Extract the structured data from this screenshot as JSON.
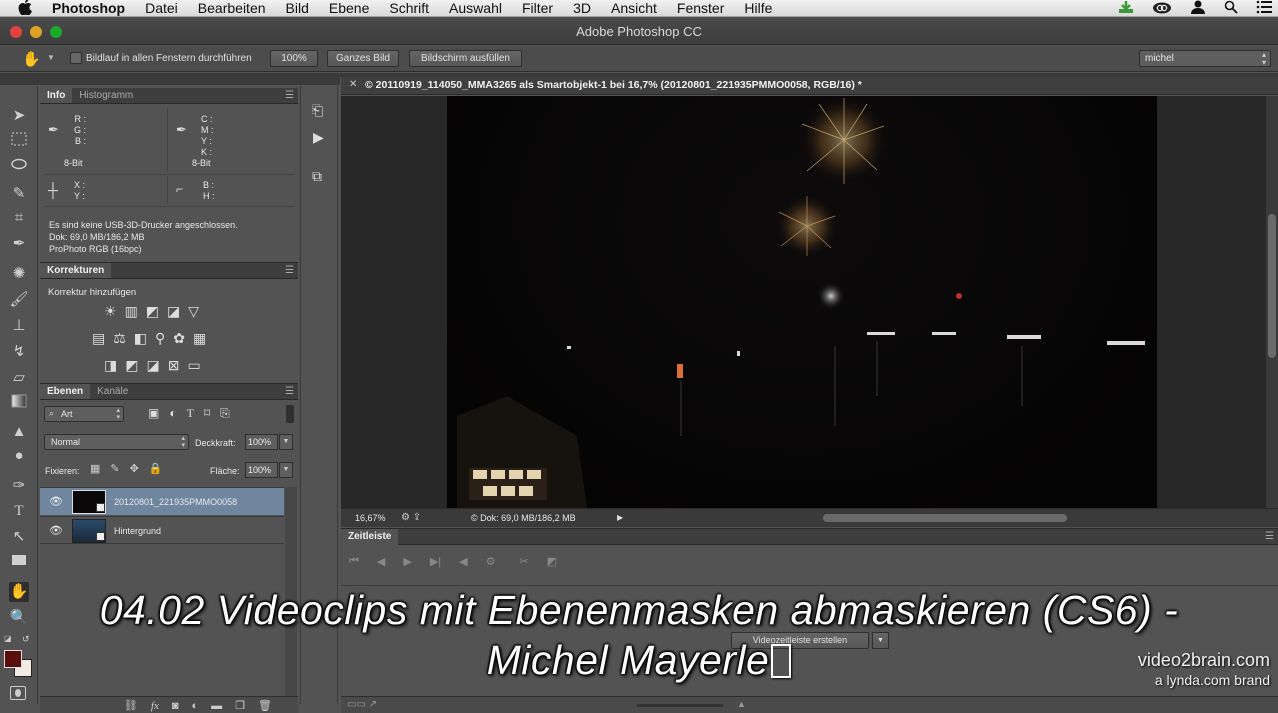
{
  "menubar": {
    "app": "Photoshop",
    "items": [
      "Datei",
      "Bearbeiten",
      "Bild",
      "Ebene",
      "Schrift",
      "Auswahl",
      "Filter",
      "3D",
      "Ansicht",
      "Fenster",
      "Hilfe"
    ]
  },
  "window": {
    "title": "Adobe Photoshop CC"
  },
  "options": {
    "scroll_all_label": "Bildlauf in allen Fenstern durchführen",
    "zoom100": "100%",
    "fit_screen": "Ganzes Bild",
    "fill_screen": "Bildschirm ausfüllen",
    "workspace": "michel"
  },
  "info_panel": {
    "tabs": [
      "Info",
      "Histogramm"
    ],
    "rgb_labels": [
      "R :",
      "G :",
      "B :"
    ],
    "cmyk_labels": [
      "C :",
      "M :",
      "Y :",
      "K :"
    ],
    "bit_left": "8-Bit",
    "bit_right": "8-Bit",
    "xy_labels": [
      "X :",
      "Y :"
    ],
    "wh_labels": [
      "B :",
      "H :"
    ],
    "line1": "Es sind keine USB-3D-Drucker angeschlossen.",
    "line2": "Dok: 69,0 MB/186,2 MB",
    "line3": "ProPhoto RGB (16bpc)"
  },
  "adjust_panel": {
    "tab": "Korrekturen",
    "heading": "Korrektur hinzufügen"
  },
  "layers_panel": {
    "tabs": [
      "Ebenen",
      "Kanäle"
    ],
    "filter": "Art",
    "blend_mode": "Normal",
    "opacity_label": "Deckkraft:",
    "opacity": "100%",
    "lock_label": "Fixieren:",
    "fill_label": "Fläche:",
    "fill": "100%",
    "layers": [
      {
        "name": "20120801_221935PMMO0058",
        "selected": true
      },
      {
        "name": "Hintergrund",
        "selected": false
      }
    ]
  },
  "document": {
    "tab_label": "© 20110919_114050_MMA3265 als Smartobjekt-1 bei 16,7% (20120801_221935PMMO0058, RGB/16) *",
    "zoom": "16,67%",
    "doc_size": "© Dok: 69,0 MB/186,2 MB"
  },
  "timeline": {
    "tab": "Zeitleiste",
    "create_button": "Videozeitleiste erstellen"
  },
  "overlay": {
    "line1": "04.02 Videoclips mit Ebenenmasken abmaskieren (CS6) -",
    "line2": "Michel Mayerle"
  },
  "branding": {
    "name": "video2brain.com",
    "sub": "a lynda.com brand"
  },
  "colors": {
    "foreground": "#5a0e0e",
    "background": "#f0ece4",
    "selected_layer": "#6f869e"
  }
}
